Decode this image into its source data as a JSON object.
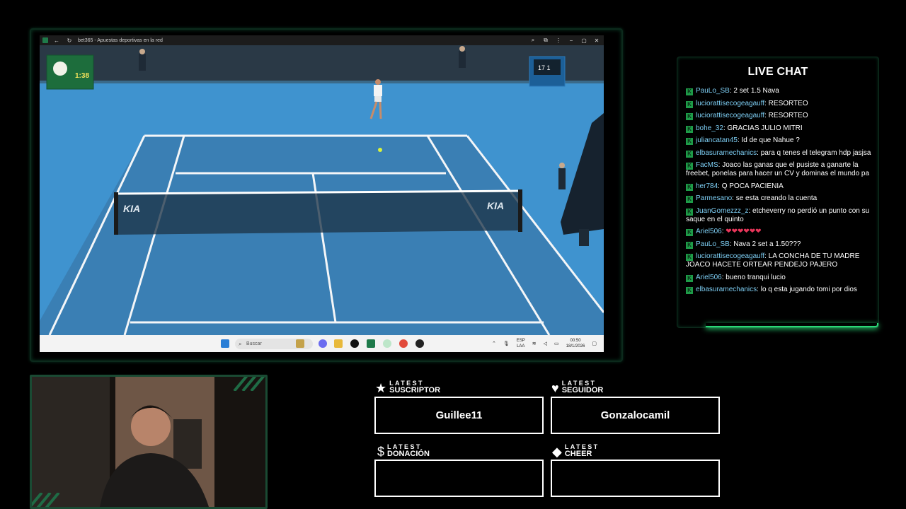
{
  "browser": {
    "title": "bet365 - Apuestas deportivas en la red",
    "controls": [
      "−",
      "▢",
      "✕"
    ]
  },
  "scoreboard": {
    "left_time": "1:38",
    "right_score": "17 1"
  },
  "taskbar": {
    "search_placeholder": "Buscar",
    "lang_top": "ESP",
    "lang_bottom": "LAA",
    "time": "00:50",
    "date": "18/1/2026"
  },
  "chat": {
    "title": "LIVE CHAT",
    "messages": [
      {
        "user": "PauLo_SB",
        "text": "2 set 1.5 Nava"
      },
      {
        "user": "luciorattisecogeagauff",
        "text": "RESORTEO"
      },
      {
        "user": "luciorattisecogeagauff",
        "text": "RESORTEO"
      },
      {
        "user": "bohe_32",
        "text": "GRACIAS JULIO MITRI"
      },
      {
        "user": "juliancatan45",
        "text": "Id de que Nahue ?"
      },
      {
        "user": "elbasuramechanics",
        "text": "para q tenes el telegram hdp jasjsa"
      },
      {
        "user": "FacMS",
        "text": "Joaco las ganas que el pusiste a ganarte la freebet, ponelas para hacer un CV y dominas el mundo pa"
      },
      {
        "user": "her784",
        "text": "Q POCA PACIENIA"
      },
      {
        "user": "Parmesano",
        "text": "se esta creando la cuenta"
      },
      {
        "user": "JuanGomezzz_z",
        "text": "etcheverry no perdió un punto con su saque en el quinto"
      },
      {
        "user": "Ariel506",
        "text": "❤❤❤❤❤❤"
      },
      {
        "user": "PauLo_SB",
        "text": "Nava 2 set a 1.50???"
      },
      {
        "user": "luciorattisecogeagauff",
        "text": "LA CONCHA DE TU MADRE JOACO HACETE ORTEAR PENDEJO PAJERO"
      },
      {
        "user": "Ariel506",
        "text": "bueno tranqui lucio"
      },
      {
        "user": "elbasuramechanics",
        "text": "lo q esta jugando tomi por dios"
      }
    ]
  },
  "widgets": {
    "suscriptor": {
      "small": "LATEST",
      "big": "SUSCRIPTOR",
      "icon": "★",
      "value": "Guillee11"
    },
    "seguidor": {
      "small": "LATEST",
      "big": "SEGUIDOR",
      "icon": "♥",
      "value": "Gonzalocamil"
    },
    "donacion": {
      "small": "LATEST",
      "big": "DONACIÓN",
      "icon": "$",
      "value": ""
    },
    "cheer": {
      "small": "LATEST",
      "big": "CHEER",
      "icon": "◆",
      "value": ""
    }
  },
  "colors": {
    "accent_green": "#2bd877",
    "chat_username": "#7ecff5",
    "court_blue": "#3f90c9"
  }
}
